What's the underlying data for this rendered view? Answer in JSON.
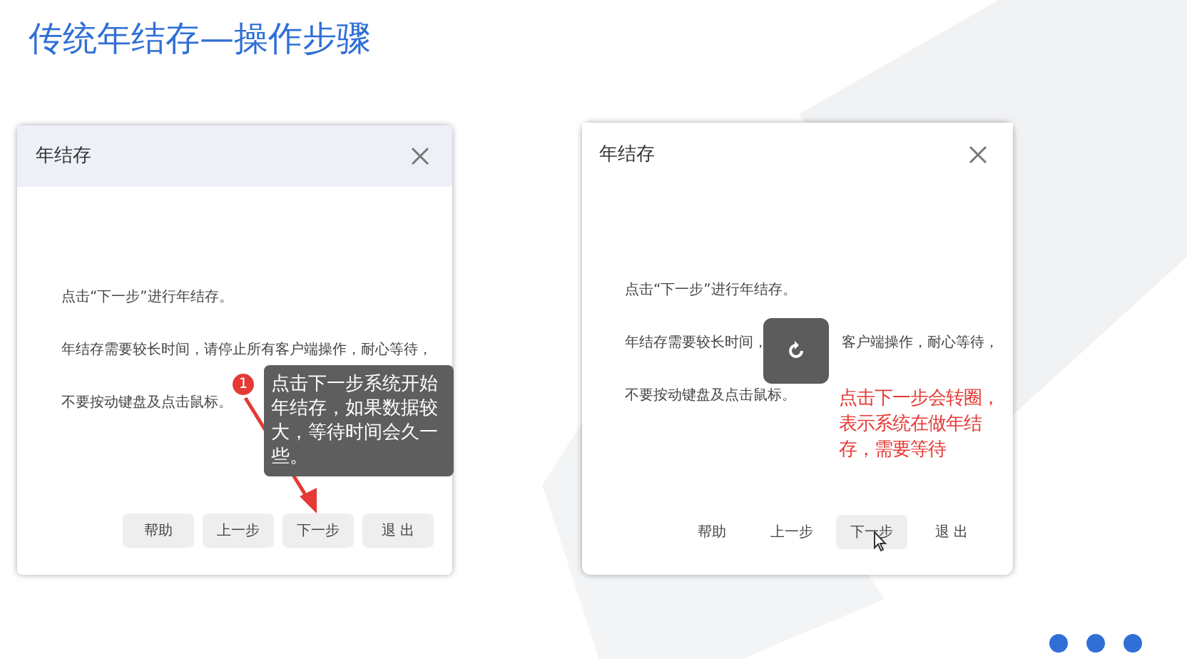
{
  "slide_title": "传统年结存—操作步骤",
  "dialogs": [
    {
      "title": "年结存",
      "header_shaded": true,
      "loading": false,
      "lines": [
        {
          "segments": [
            "点击“下一步”进行年结存。"
          ]
        },
        {
          "segments": [
            "年结存需要较长时间，请停止所有客户端操作，耐心等待，"
          ]
        },
        {
          "segments": [
            "不要按动键盘及点击鼠标。"
          ]
        }
      ],
      "buttons": [
        {
          "label": "帮助",
          "filled": true,
          "hovered": false
        },
        {
          "label": "上一步",
          "filled": true,
          "hovered": false
        },
        {
          "label": "下一步",
          "filled": true,
          "hovered": false
        },
        {
          "label": "退 出",
          "filled": true,
          "hovered": false
        }
      ],
      "callout": {
        "kind": "tooltip",
        "badge": "1",
        "text": "点击下一步系统开始年结存，如果数据较大，等待时间会久一些。"
      }
    },
    {
      "title": "年结存",
      "header_shaded": false,
      "loading": true,
      "lines": [
        {
          "segments": [
            "点击“下一步”进行年结存。"
          ]
        },
        {
          "segments": [
            "年结存需要较长时间，",
            "客户端操作，耐心等待，"
          ]
        },
        {
          "segments": [
            "不要按动键盘及点击鼠标。"
          ]
        }
      ],
      "buttons": [
        {
          "label": "帮助",
          "filled": false,
          "hovered": false
        },
        {
          "label": "上一步",
          "filled": false,
          "hovered": false
        },
        {
          "label": "下一步",
          "filled": true,
          "hovered": true
        },
        {
          "label": "退 出",
          "filled": false,
          "hovered": false
        }
      ],
      "callout": {
        "kind": "note",
        "text": "点击下一步会转圈，表示系统在做年结存，需要等待"
      }
    }
  ]
}
